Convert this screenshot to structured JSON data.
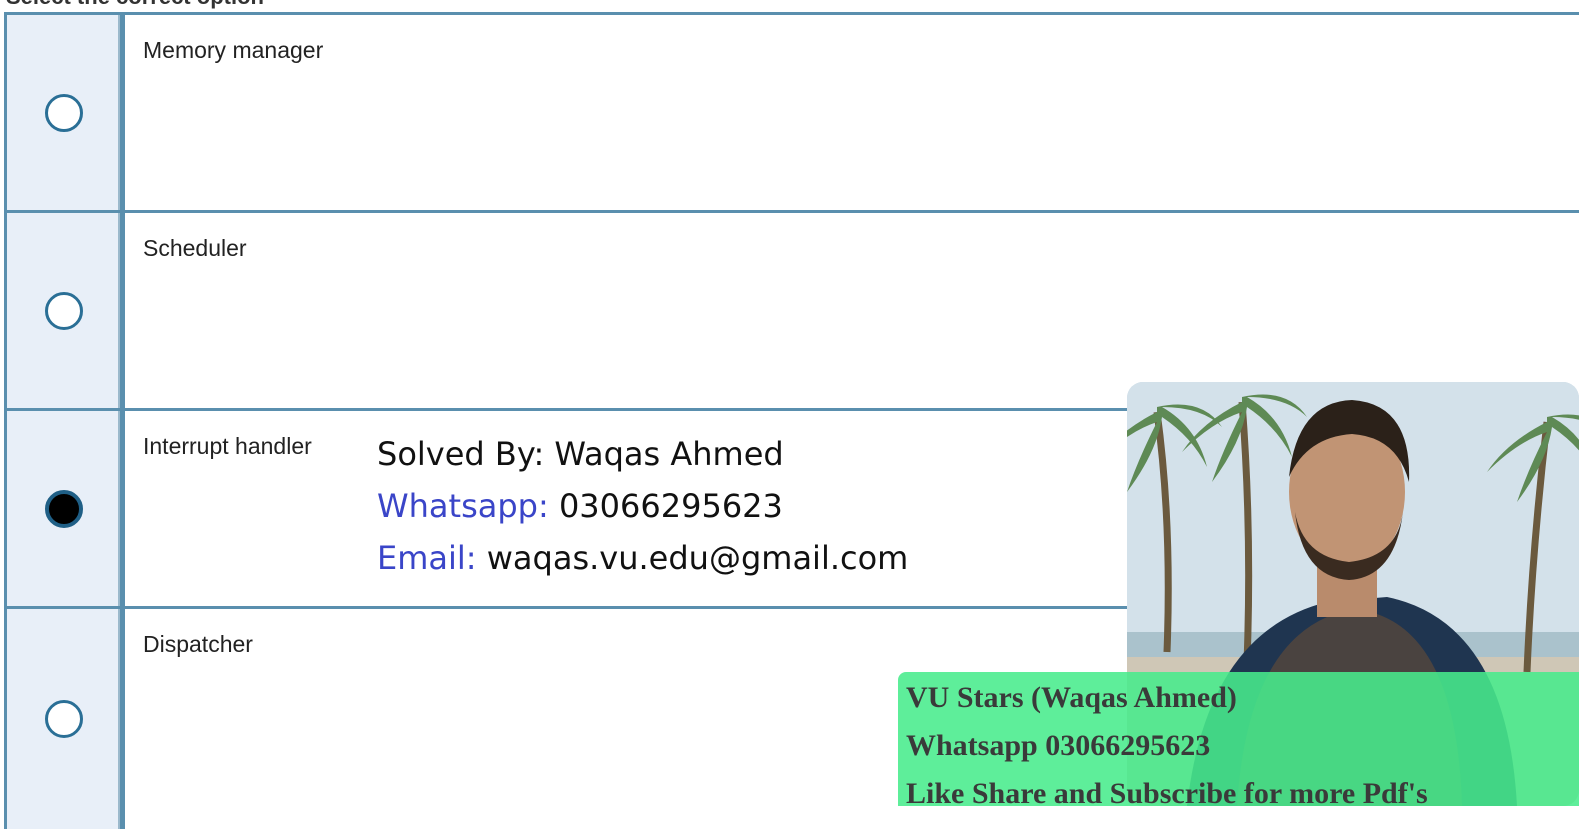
{
  "header": {
    "instruction": "Select the correct option"
  },
  "options": [
    {
      "label": "Memory manager",
      "selected": false
    },
    {
      "label": "Scheduler",
      "selected": false
    },
    {
      "label": "Interrupt handler",
      "selected": true
    },
    {
      "label": "Dispatcher",
      "selected": false
    }
  ],
  "solver": {
    "solved_by": "Solved By: Waqas Ahmed",
    "whatsapp_key": "Whatsapp:",
    "whatsapp_value": " 03066295623",
    "email_key": "Email:",
    "email_value": " waqas.vu.edu@gmail.com"
  },
  "promo": {
    "line1": "VU Stars (Waqas Ahmed)",
    "line2": "Whatsapp 03066295623",
    "line3": "Like Share and Subscribe for more Pdf's"
  },
  "colors": {
    "border": "#5a8fae",
    "radio_cell_bg": "#e8eff8",
    "link_blue": "#3a45c8",
    "promo_green": "#48ec8c"
  }
}
